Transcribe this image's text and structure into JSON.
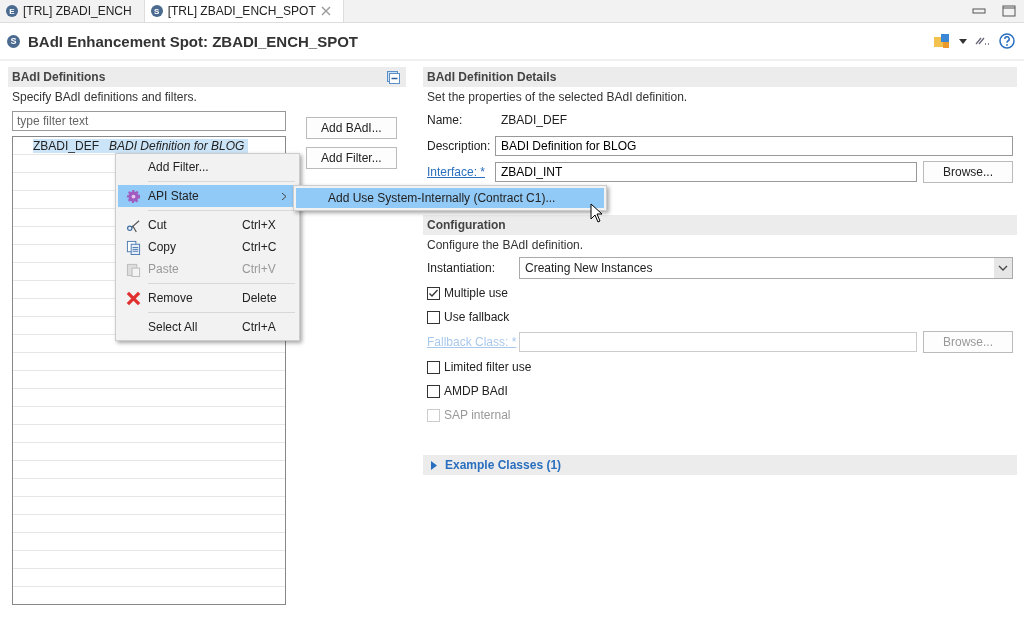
{
  "tabs": [
    {
      "badge": "E",
      "label": "[TRL] ZBADI_ENCH",
      "selected": false,
      "closable": false
    },
    {
      "badge": "S",
      "label": "[TRL] ZBADI_ENCH_SPOT",
      "selected": true,
      "closable": true
    }
  ],
  "header": {
    "badge": "S",
    "title": "BAdI Enhancement Spot: ZBADI_ENCH_SPOT"
  },
  "definitions": {
    "title": "BAdI Definitions",
    "description": "Specify BAdI definitions and filters.",
    "filter": {
      "placeholder": "type filter text"
    },
    "rows": [
      {
        "name": "ZBADI_DEF",
        "description": "BADI Definition for BLOG",
        "selected": true
      }
    ],
    "buttons": [
      "Add BAdI...",
      "Add Filter..."
    ]
  },
  "context_menu": [
    {
      "label": "Add Filter...",
      "disabled": false,
      "selected": false,
      "submenu": false,
      "separator_after": true
    },
    {
      "label": "API State",
      "disabled": false,
      "selected": true,
      "submenu": true,
      "separator_after": true
    },
    {
      "label": "Cut",
      "shortcut": "Ctrl+X",
      "disabled": false,
      "selected": false,
      "submenu": false,
      "separator_after": false
    },
    {
      "label": "Copy",
      "shortcut": "Ctrl+C",
      "disabled": false,
      "selected": false,
      "submenu": false,
      "separator_after": false
    },
    {
      "label": "Paste",
      "shortcut": "Ctrl+V",
      "disabled": true,
      "selected": false,
      "submenu": false,
      "separator_after": true
    },
    {
      "label": "Remove",
      "shortcut": "Delete",
      "disabled": false,
      "selected": false,
      "submenu": false,
      "separator_after": true
    },
    {
      "label": "Select All",
      "shortcut": "Ctrl+A",
      "disabled": false,
      "selected": false,
      "submenu": false,
      "separator_after": false
    }
  ],
  "submenu": [
    {
      "label": "Add Use System-Internally (Contract C1)...",
      "selected": true
    }
  ],
  "details": {
    "title": "BAdI Definition Details",
    "description": "Set the properties of the selected BAdI definition.",
    "name": {
      "label": "Name:",
      "value": "ZBADI_DEF"
    },
    "desc": {
      "label": "Description:",
      "value": "BADI Definition for BLOG"
    },
    "interface": {
      "label": "Interface: *",
      "value": "ZBADI_INT",
      "button": "Browse..."
    }
  },
  "configuration": {
    "title": "Configuration",
    "description": "Configure the BAdI definition.",
    "instantiation": {
      "label": "Instantiation:",
      "value": "Creating New Instances"
    },
    "rows": [
      {
        "kind": "checkbox",
        "label": "Multiple use",
        "checked": true,
        "disabled": false
      },
      {
        "kind": "checkbox",
        "label": "Use fallback",
        "checked": false,
        "disabled": false
      },
      {
        "kind": "field",
        "label": "Fallback Class: *",
        "button": "Browse...",
        "disabled": true
      },
      {
        "kind": "checkbox",
        "label": "Limited filter use",
        "checked": false,
        "disabled": false
      },
      {
        "kind": "checkbox",
        "label": "AMDP BAdI",
        "checked": false,
        "disabled": false
      },
      {
        "kind": "checkbox",
        "label": "SAP internal",
        "checked": false,
        "disabled": true
      }
    ]
  },
  "example_classes": {
    "title": "Example Classes (1)",
    "expanded": false
  }
}
